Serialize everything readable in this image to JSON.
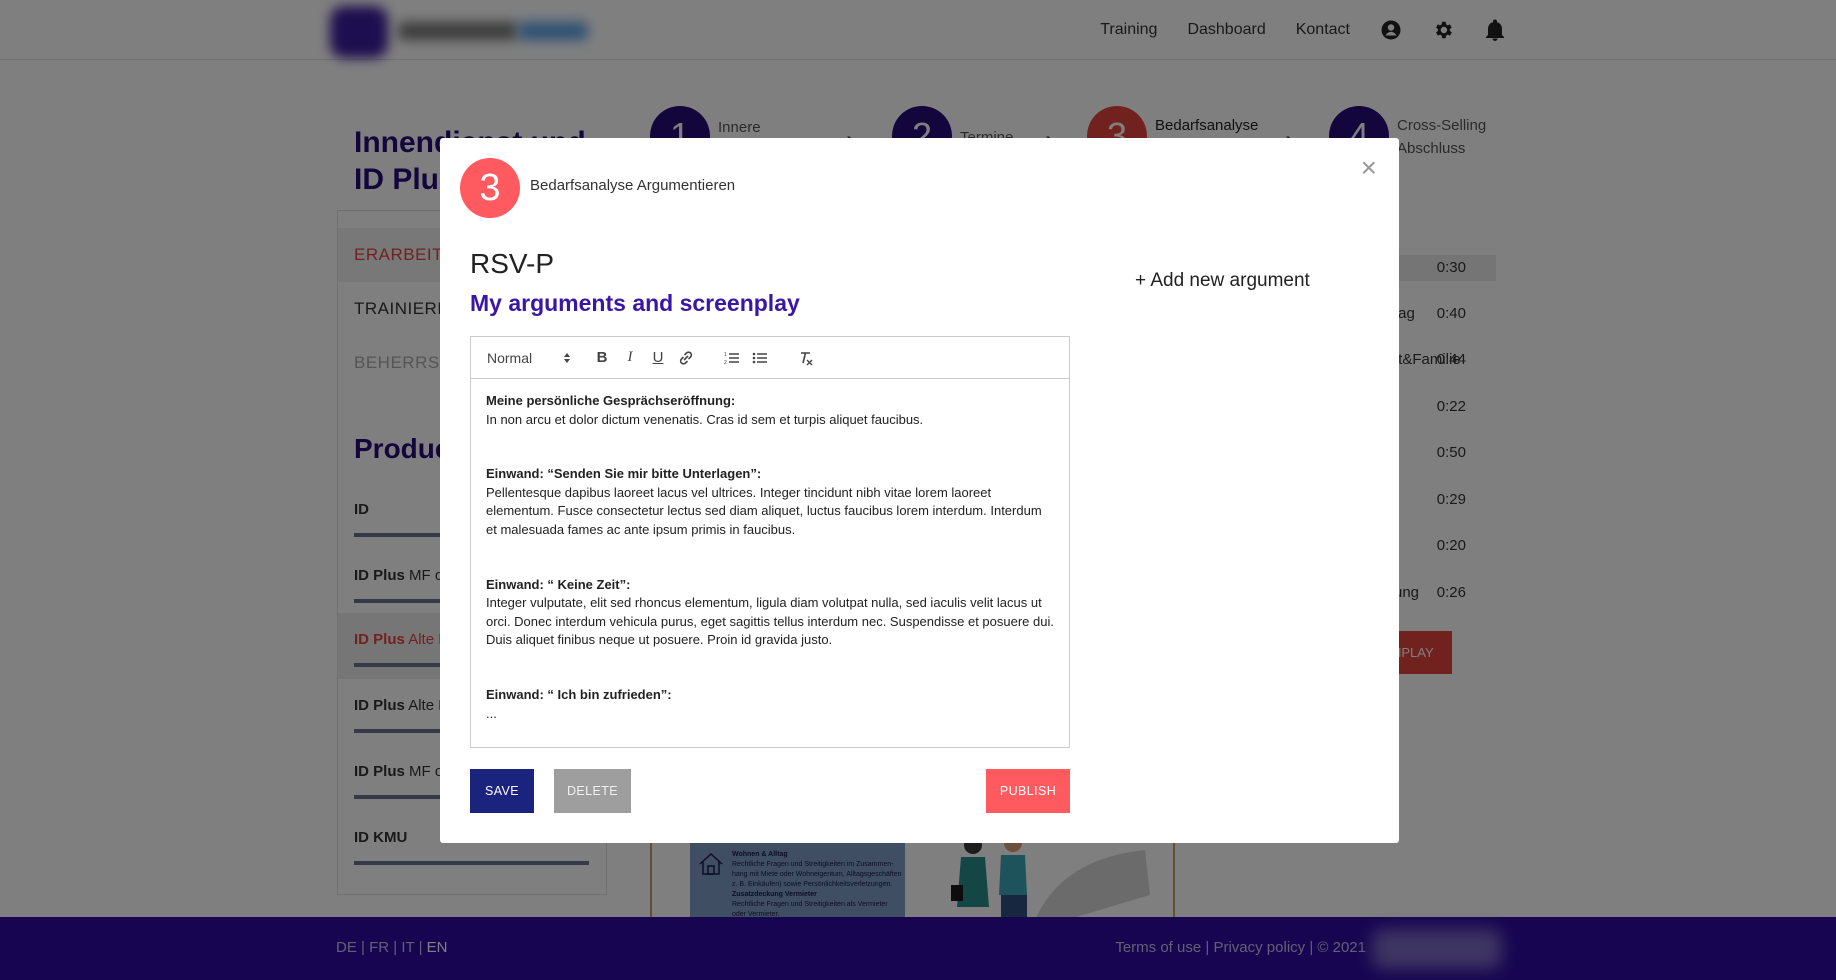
{
  "nav": {
    "items": [
      "Training",
      "Dashboard",
      "Kontact"
    ],
    "icons": [
      "user-circle-icon",
      "gear-icon",
      "bell-icon"
    ]
  },
  "steps": [
    {
      "number": "1",
      "label_line1": "Innere",
      "label_line2": ""
    },
    {
      "number": "2",
      "label_line1": "Termine",
      "label_line2": ""
    },
    {
      "number": "3",
      "label_line1": "Bedarfsanalyse",
      "label_line2": ""
    },
    {
      "number": "4",
      "label_line1": "Cross-Selling",
      "label_line2": "Abschluss"
    }
  ],
  "page": {
    "title_line1": "Innendienst und",
    "title_line2": "ID Plus"
  },
  "left_menu": {
    "items": [
      "ERARBEITEN",
      "TRAINIEREN",
      "BEHERRSCHEN"
    ],
    "products_heading": "Products",
    "products": [
      {
        "bold": "ID",
        "rest": ""
      },
      {
        "bold": "ID Plus",
        "rest": " MF ohne"
      },
      {
        "bold": "ID Plus",
        "rest": " Alte F"
      },
      {
        "bold": "ID Plus",
        "rest": " Alte H"
      },
      {
        "bold": "ID Plus",
        "rest": " MF oh"
      },
      {
        "bold": "ID KMU",
        "rest": ""
      }
    ]
  },
  "right_list": {
    "rows": [
      {
        "text": "",
        "time": "0:30"
      },
      {
        "text": "tag",
        "time": "0:40"
      },
      {
        "text": "ft&Familie",
        "time": "0:44"
      },
      {
        "text": "",
        "time": "0:22"
      },
      {
        "text": "",
        "time": "0:50"
      },
      {
        "text": "",
        "time": "0:29"
      },
      {
        "text": ".",
        "time": "0:20"
      },
      {
        "text": "ung",
        "time": "0:26"
      }
    ],
    "button": "NPLAY"
  },
  "thumb": {
    "lines": [
      "Wohnen & Alltag",
      "Rechtliche Fragen und Streitigkeiten im Zusammen-",
      "hang mit Miete oder Wohneigentum, Alltagsgeschäften",
      "z. B. Einkäufen) sowie Persönlichkeitsverletzungen.",
      "Zusatzdeckung Vermieter",
      "Rechtliche Fragen und Streitigkeiten als Vermieter",
      "oder Vermieter."
    ]
  },
  "footer": {
    "lang_de": "DE",
    "lang_fr": "FR",
    "lang_it": "IT",
    "lang_en": "EN",
    "sep": "|",
    "terms": "Terms of use",
    "privacy": "Privacy policy",
    "copyright": "© 2021"
  },
  "modal": {
    "step_number": "3",
    "step_title": "Bedarfsanalyse Argumentieren",
    "close": "×",
    "title": "RSV-P",
    "subtitle": "My arguments and screenplay",
    "add_argument": "+ Add new argument",
    "editor": {
      "format_select": "Normal",
      "blocks": [
        {
          "heading": "Meine persönliche Gesprächseröffnung:",
          "body": "In non arcu et dolor dictum venenatis. Cras id sem et turpis aliquet faucibus."
        },
        {
          "heading": "Einwand: “Senden Sie mir bitte Unterlagen”:",
          "body": "Pellentesque dapibus laoreet lacus vel ultrices. Integer tincidunt nibh vitae lorem laoreet elementum. Fusce consectetur lectus sed diam aliquet, luctus faucibus lorem interdum. Interdum et malesuada fames ac ante ipsum primis in faucibus."
        },
        {
          "heading": "Einwand: “ Keine Zeit”:",
          "body": "Integer vulputate, elit sed rhoncus elementum, ligula diam volutpat nulla, sed iaculis velit lacus ut orci. Donec interdum vehicula purus, eget sagittis tellus interdum nec. Suspendisse et posuere dui. Duis aliquet finibus neque ut posuere. Proin id gravida justo."
        },
        {
          "heading": "Einwand: “ Ich bin zufrieden”:",
          "body": "..."
        }
      ]
    },
    "buttons": {
      "save": "SAVE",
      "delete": "DELETE",
      "publish": "PUBLISH"
    }
  },
  "colors": {
    "brand_purple": "#260d7a",
    "accent_red": "#ff5a5f",
    "save_navy": "#1a237e",
    "footer_purple": "#2f0ba4"
  }
}
